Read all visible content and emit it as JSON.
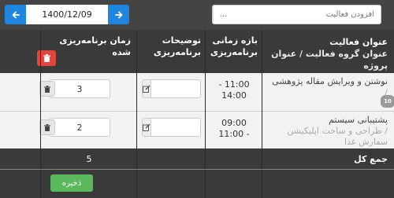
{
  "toolbar": {
    "add_activity_placeholder": "افزودن فعالیت",
    "browse_label": "...",
    "date_value": "1400/12/09",
    "prev_icon": "arrow-left-icon",
    "next_icon": "arrow-right-icon"
  },
  "table": {
    "headers": {
      "activity": "عنوان فعالیت",
      "activity_sub": "عنوان گروه فعالیت  / عنوان پروژه",
      "period": "بازه زمانی برنامه‌ریزی",
      "description": "توضیحات برنامه‌ریزی",
      "planned_time": "زمان برنامه‌ریزی شده"
    },
    "rows": [
      {
        "title": "نوشتن و ویرایش مقاله پژوهشی",
        "group": "/",
        "badge": "10",
        "period_start": "11:00 -",
        "period_end": "14:00",
        "planned_time": "3"
      },
      {
        "title": "پشتیبانی سیستم",
        "group": "/ طراحی و ساخت اپلیکیشن",
        "group_extra": "سفارش غذا",
        "period_start": "09:00",
        "period_end": "- 11:00",
        "planned_time": "2"
      }
    ],
    "total_label": "جمع کل",
    "total_value": "5"
  },
  "actions": {
    "save_label": "ذخیره"
  },
  "colors": {
    "primary": "#1f86e0",
    "danger": "#e0453e",
    "success": "#5cb85c"
  }
}
